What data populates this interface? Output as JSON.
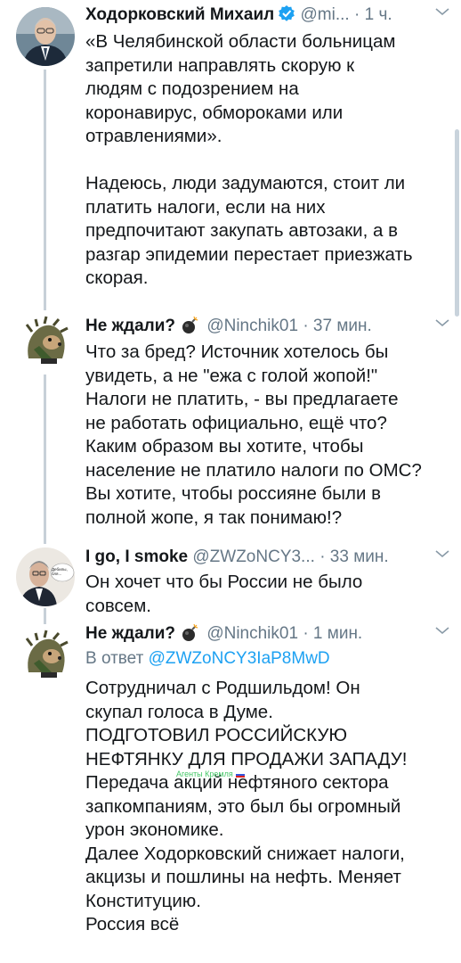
{
  "tweets": [
    {
      "author": "Ходорковский Михаил",
      "handle": "@mi...",
      "separator": "·",
      "time": "1 ч.",
      "text": "«В Челябинской области больницам\nзапретили направлять скорую к\nлюдям с подозрением на\nкоронавирус, обмороками или\nотравлениями».\n\nНадеюсь, люди задумаются, стоит ли\nплатить налоги, если на них\nпредпочитают закупать автозаки, а в\nразгар эпидемии перестает приезжать\nскорая."
    },
    {
      "author": "Не ждали?",
      "handle": "@Ninchik01",
      "separator": "·",
      "time": "37 мин.",
      "text": "Что за бред? Источник хотелось бы\nувидеть, а не \"ежа с голой жопой!\"\nНалоги не платить, - вы предлагаете\nне работать официально, ещё что?\nКаким образом вы хотите, чтобы\nнаселение не платило налоги по ОМС?\nВы хотите, чтобы россияне были в\nполной жопе, я так понимаю!?"
    },
    {
      "author": "I go, I smoke",
      "handle": "@ZWZoNCY3...",
      "separator": "·",
      "time": "33 мин.",
      "avatar_text": "Дебилы,\nбля...",
      "text": "Он хочет что бы России не было\nсовсем."
    },
    {
      "author": "Не ждали?",
      "handle": "@Ninchik01",
      "separator": "·",
      "time": "1 мин.",
      "reply_prefix": "В ответ",
      "reply_handle": "@ZWZoNCY3IaP8MwD",
      "text": "Сотрудничал с Родшильдом! Он\nскупал голоса в Думе.\nПОДГОТОВИЛ РОССИЙСКУЮ\nНЕФТЯНКУ ДЛЯ ПРОДАЖИ ЗАПАДУ!\nПередача акций нефтяного сектора\nзапкомпаниям, это был бы огромный\nурон экономике.\nДалее Ходорковский снижает налоги,\nакцизы и пошлины на нефть. Меняет\nКонституцию.\nРоссия всё"
    }
  ],
  "watermark": "Агенты Кремля",
  "icons": [
    "verified-badge-icon",
    "bomb-emoji-icon",
    "chevron-down-icon"
  ],
  "colors": {
    "link": "#1da1f2",
    "muted": "#657786",
    "thread": "#c7d0d8",
    "watermark": "#44c767"
  }
}
